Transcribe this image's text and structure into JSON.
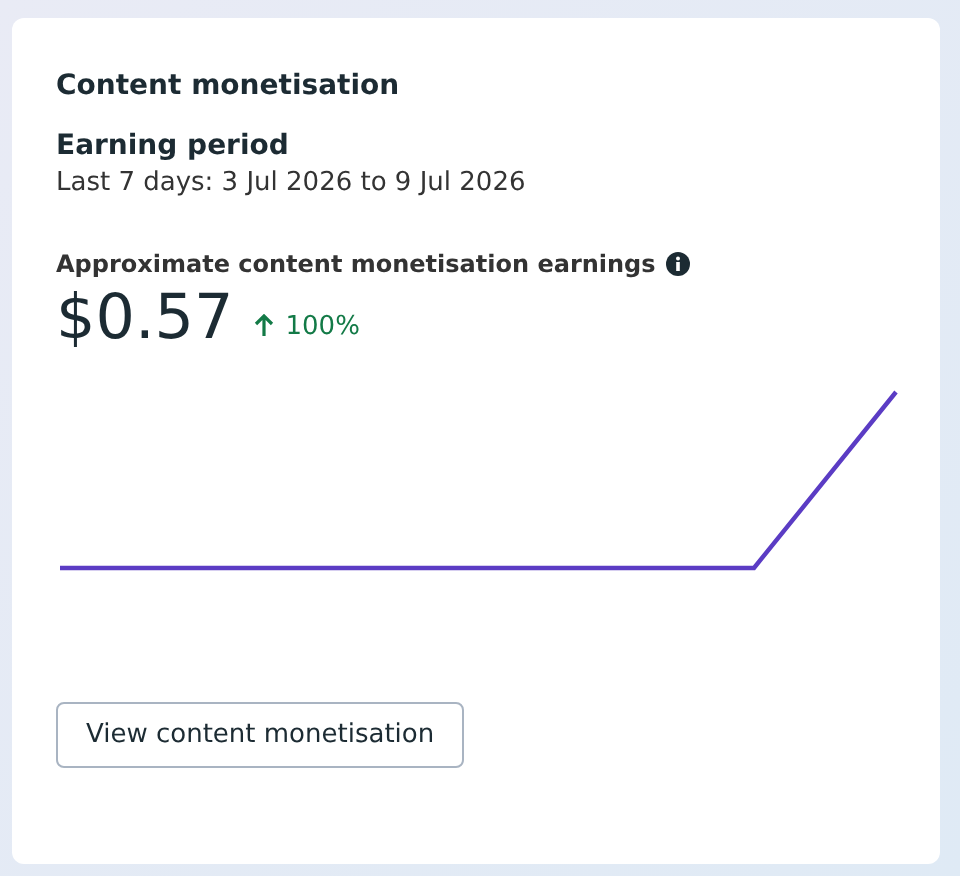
{
  "card": {
    "title": "Content monetisation",
    "period": {
      "heading": "Earning period",
      "range": "Last 7 days: 3 Jul 2026 to 9 Jul 2026"
    },
    "metric": {
      "label": "Approximate content monetisation earnings",
      "value": "$0.57",
      "change": "100%",
      "rising": true
    },
    "button": "View content monetisation"
  }
}
